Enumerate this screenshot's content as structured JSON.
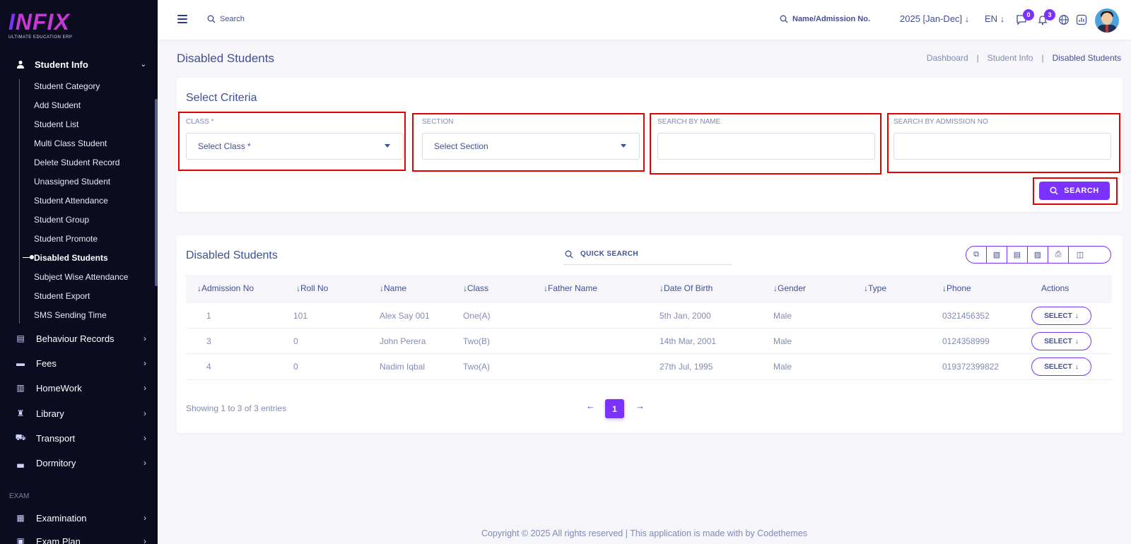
{
  "logo": {
    "brand_a": "I",
    "brand_b": "NFIX",
    "tagline": "ULTIMATE EDUCATION ERP"
  },
  "sidebar": {
    "active_group": "Student Info",
    "sub_items": [
      "Student Category",
      "Add Student",
      "Student List",
      "Multi Class Student",
      "Delete Student Record",
      "Unassigned Student",
      "Student Attendance",
      "Student Group",
      "Student Promote",
      "Disabled Students",
      "Subject Wise Attendance",
      "Student Export",
      "SMS Sending Time"
    ],
    "active_sub": "Disabled Students",
    "groups": [
      "Behaviour Records",
      "Fees",
      "HomeWork",
      "Library",
      "Transport",
      "Dormitory"
    ],
    "section_label": "EXAM",
    "exam_groups": [
      "Examination",
      "Exam Plan"
    ]
  },
  "topbar": {
    "search_placeholder": "Search",
    "name_search": "Name/Admission No.",
    "year": "2025 [Jan-Dec]",
    "lang": "EN",
    "chat_badge": "0",
    "notif_badge": "3"
  },
  "page": {
    "title": "Disabled Students",
    "breadcrumb": [
      "Dashboard",
      "Student Info",
      "Disabled Students"
    ]
  },
  "criteria": {
    "title": "Select Criteria",
    "class_label": "CLASS *",
    "class_placeholder": "Select Class *",
    "section_label": "SECTION",
    "section_placeholder": "Select Section",
    "name_label": "SEARCH BY NAME",
    "name_value": "",
    "admission_label": "SEARCH BY ADMISSION NO",
    "admission_value": "",
    "search_button": "SEARCH"
  },
  "table": {
    "title": "Disabled Students",
    "quick_search": "QUICK SEARCH",
    "columns": [
      "Admission No",
      "Roll No",
      "Name",
      "Class",
      "Father Name",
      "Date Of Birth",
      "Gender",
      "Type",
      "Phone",
      "Actions"
    ],
    "rows": [
      {
        "admission": "1",
        "roll": "101",
        "name": "Alex Say 001",
        "class": "One(A)",
        "father": "",
        "dob": "5th Jan, 2000",
        "gender": "Male",
        "type": "",
        "phone": "0321456352",
        "action": "SELECT"
      },
      {
        "admission": "3",
        "roll": "0",
        "name": "John Perera",
        "class": "Two(B)",
        "father": "",
        "dob": "14th Mar, 2001",
        "gender": "Male",
        "type": "",
        "phone": "0124358999",
        "action": "SELECT"
      },
      {
        "admission": "4",
        "roll": "0",
        "name": "Nadim Iqbal",
        "class": "Two(A)",
        "father": "",
        "dob": "27th Jul, 1995",
        "gender": "Male",
        "type": "",
        "phone": "019372399822",
        "action": "SELECT"
      }
    ],
    "showing": "Showing 1 to 3 of 3 entries",
    "current_page": "1"
  },
  "footer": "Copyright © 2025 All rights reserved | This application is made with by Codethemes",
  "colors": {
    "accent": "#7c32ff",
    "sidebar_bg": "#0b0c1f",
    "text": "#415094",
    "highlight_box": "#e60000"
  }
}
